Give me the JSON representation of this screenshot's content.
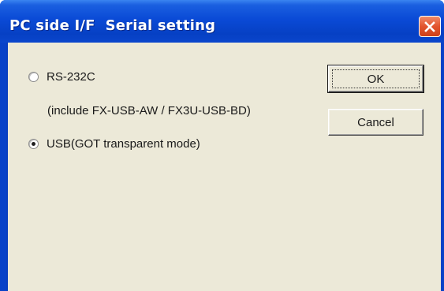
{
  "window": {
    "title": "PC side I/F  Serial setting"
  },
  "options": {
    "rs232c_label": "RS-232C",
    "rs232c_note": "(include FX-USB-AW / FX3U-USB-BD)",
    "usb_label": "USB(GOT transparent mode)",
    "selected": "usb"
  },
  "buttons": {
    "ok_label": "OK",
    "cancel_label": "Cancel"
  },
  "icons": {
    "close": "close-icon"
  }
}
